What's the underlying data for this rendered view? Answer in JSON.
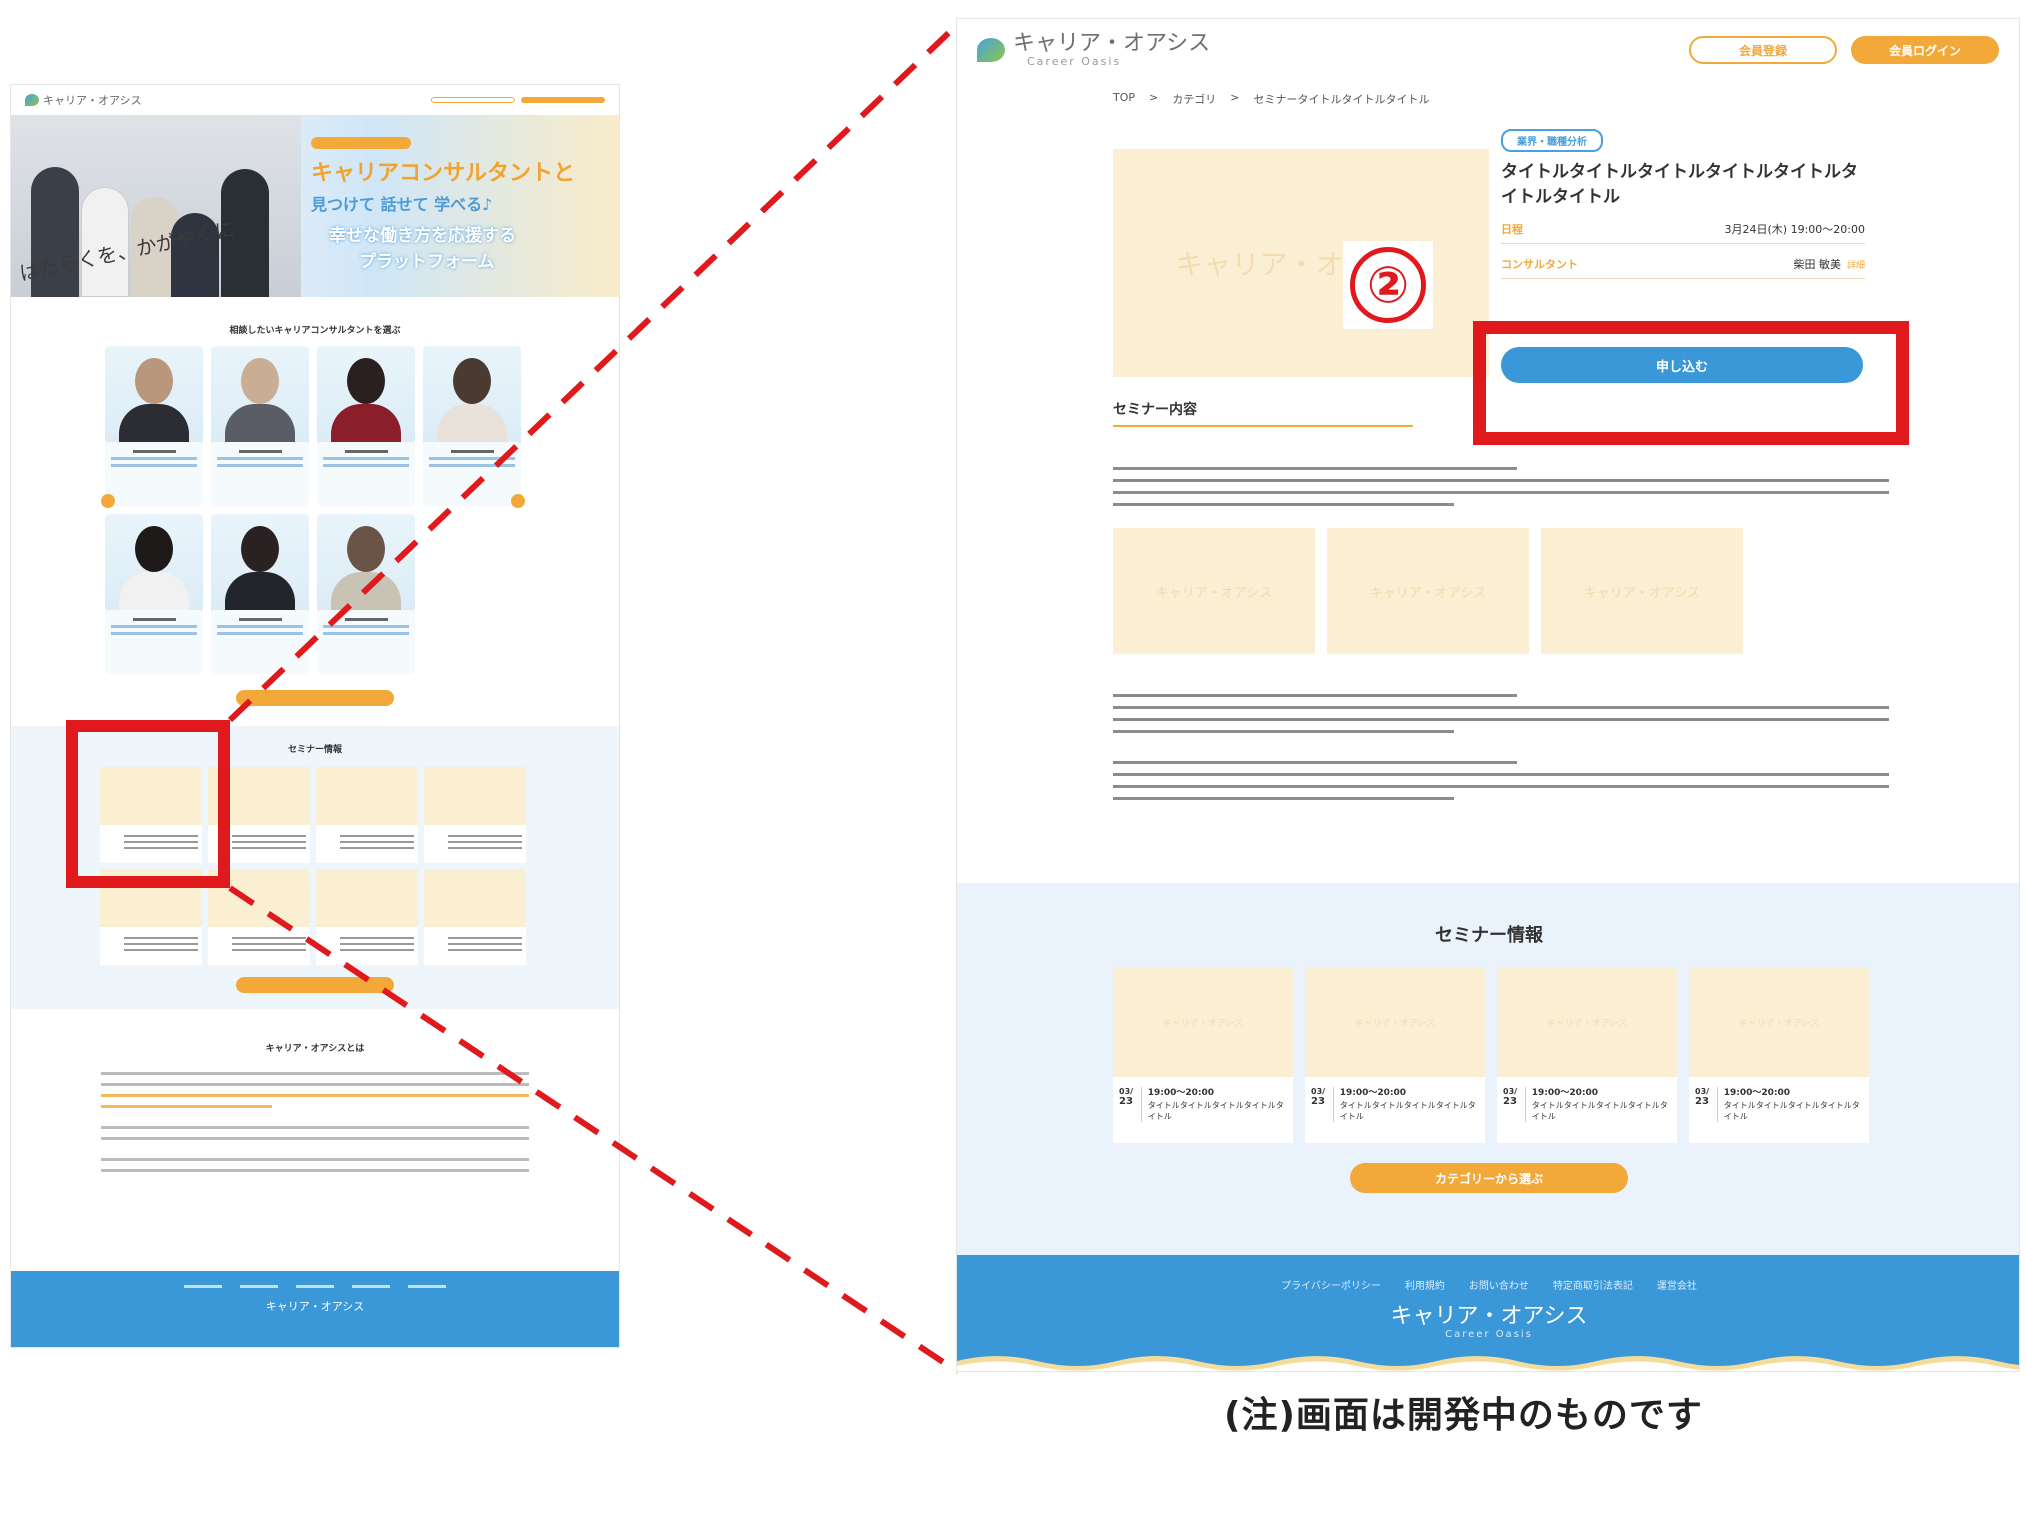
{
  "brand": {
    "name": "キャリア・オアシス",
    "tagline": "Career Oasis"
  },
  "header": {
    "register": "会員登録",
    "login": "会員ログイン"
  },
  "breadcrumb": [
    "TOP",
    ">",
    "カテゴリ",
    ">",
    "セミナータイトルタイトルタイトル"
  ],
  "thumbnail": {
    "hero_script": "はたらくを、かがやくに",
    "hero_title": "キャリアコンサルタントと",
    "hero_sub": "見つけて 話せて 学べる♪",
    "hero_sub2": "幸せな働き方を応援する",
    "hero_sub3": "プラットフォーム",
    "consultants_title": "相談したいキャリアコンサルタントを選ぶ",
    "seminar_title": "セミナー情報",
    "about_title": "キャリア・オアシスとは"
  },
  "seminar_detail": {
    "tag": "業界・職種分析",
    "title": "タイトルタイトルタイトルタイトルタイトルタイトルタイトル",
    "image_watermark": "キャリア・オアシス",
    "callout_number": "②",
    "rows": [
      {
        "label": "日程",
        "value": "3月24日(木) 19:00〜20:00"
      },
      {
        "label": "コンサルタント",
        "value": "柴田 敏美",
        "badge": "詳細"
      }
    ],
    "apply_button": "申し込む",
    "content_title": "セミナー内容",
    "thumb_watermark": "キャリア・オアシス"
  },
  "seminar_section": {
    "title": "セミナー情報",
    "cards": [
      {
        "month": "03/",
        "day": "23",
        "time": "19:00〜20:00",
        "desc": "タイトルタイトルタイトルタイトルタイトル"
      },
      {
        "month": "03/",
        "day": "23",
        "time": "19:00〜20:00",
        "desc": "タイトルタイトルタイトルタイトルタイトル"
      },
      {
        "month": "03/",
        "day": "23",
        "time": "19:00〜20:00",
        "desc": "タイトルタイトルタイトルタイトルタイトル"
      },
      {
        "month": "03/",
        "day": "23",
        "time": "19:00〜20:00",
        "desc": "タイトルタイトルタイトルタイトルタイトル"
      }
    ],
    "category_button": "カテゴリーから選ぶ"
  },
  "footer": {
    "links": [
      "プライバシーポリシー",
      "利用規約",
      "お問い合わせ",
      "特定商取引法表記",
      "運営会社"
    ]
  },
  "note": "(注)画面は開発中のものです",
  "colors": {
    "accent_orange": "#f3a93a",
    "accent_blue": "#3a97d8",
    "highlight_red": "#e0191d",
    "placeholder": "#fbefd3"
  }
}
